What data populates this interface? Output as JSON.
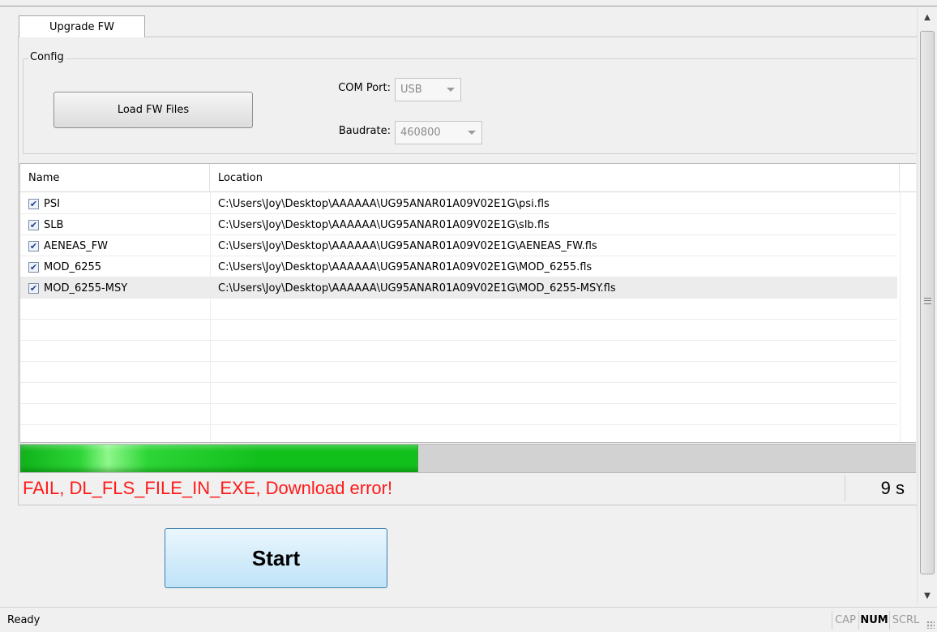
{
  "tab": {
    "label": "Upgrade FW"
  },
  "config": {
    "group_title": "Config",
    "load_button": "Load FW Files",
    "com_port_label": "COM Port:",
    "com_port_value": "USB",
    "baudrate_label": "Baudrate:",
    "baudrate_value": "460800"
  },
  "table": {
    "columns": [
      "Name",
      "Location"
    ],
    "rows": [
      {
        "checked": true,
        "name": "PSI",
        "location": "C:\\Users\\Joy\\Desktop\\AAAAAA\\UG95ANAR01A09V02E1G\\psi.fls"
      },
      {
        "checked": true,
        "name": "SLB",
        "location": "C:\\Users\\Joy\\Desktop\\AAAAAA\\UG95ANAR01A09V02E1G\\slb.fls"
      },
      {
        "checked": true,
        "name": "AENEAS_FW",
        "location": "C:\\Users\\Joy\\Desktop\\AAAAAA\\UG95ANAR01A09V02E1G\\AENEAS_FW.fls"
      },
      {
        "checked": true,
        "name": "MOD_6255",
        "location": "C:\\Users\\Joy\\Desktop\\AAAAAA\\UG95ANAR01A09V02E1G\\MOD_6255.fls"
      },
      {
        "checked": true,
        "name": "MOD_6255-MSY",
        "location": "C:\\Users\\Joy\\Desktop\\AAAAAA\\UG95ANAR01A09V02E1G\\MOD_6255-MSY.fls"
      }
    ]
  },
  "progress": {
    "fraction": 0.444,
    "color": "#12c01c"
  },
  "status": {
    "message": "FAIL, DL_FLS_FILE_IN_EXE, Download error!",
    "message_color": "#ff1a1a",
    "elapsed": "9 s"
  },
  "start_button": "Start",
  "statusbar": {
    "ready": "Ready",
    "cap": "CAP",
    "num": "NUM",
    "scrl": "SCRL"
  }
}
